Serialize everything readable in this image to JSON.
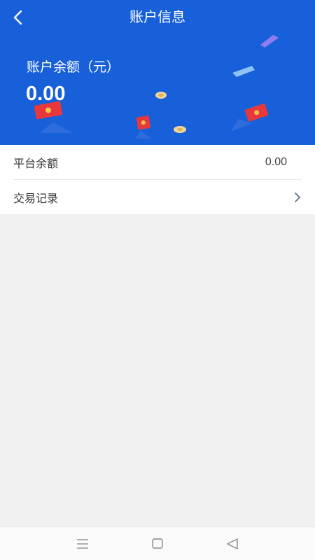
{
  "header": {
    "title": "账户信息",
    "balance_label": "账户余额（元）",
    "balance_value": "0.00"
  },
  "list": {
    "platform_balance_label": "平台余额",
    "platform_balance_value": "0.00",
    "transactions_label": "交易记录"
  },
  "nav": {
    "icons": [
      "menu-icon",
      "home-square-icon",
      "back-triangle-icon"
    ]
  },
  "colors": {
    "header_bg": "#1760d9",
    "page_bg": "#f0f0f0"
  }
}
